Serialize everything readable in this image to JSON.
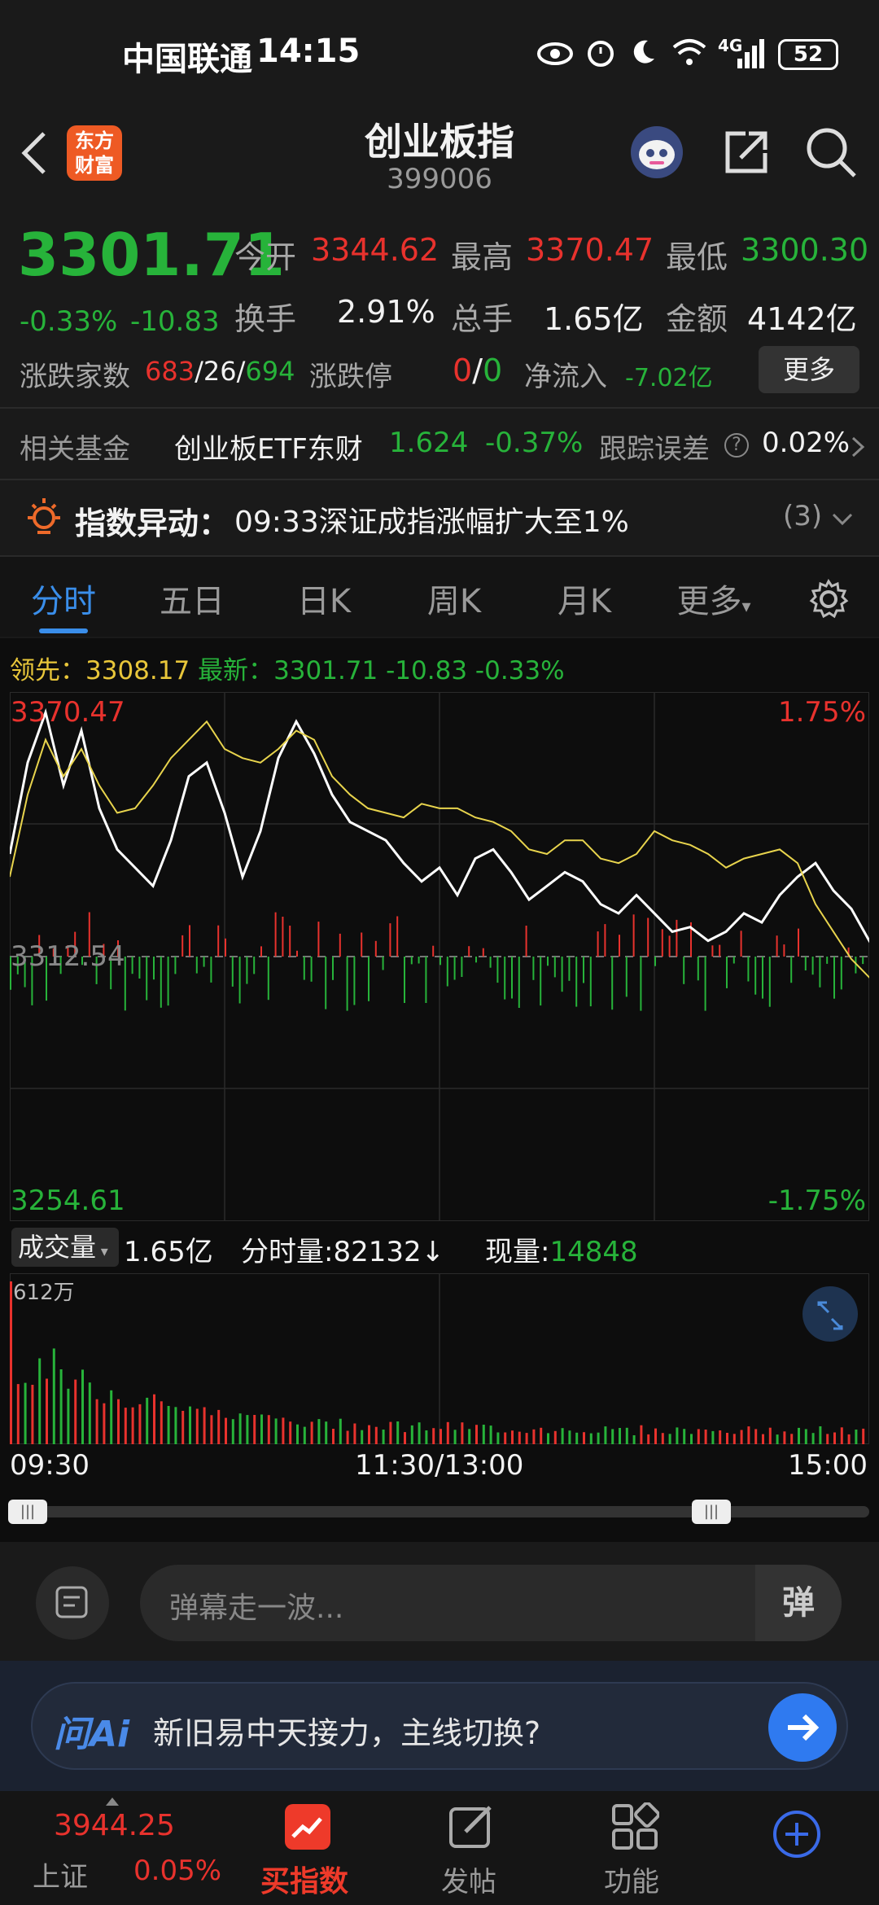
{
  "status_bar": {
    "carrier": "中国联通",
    "time": "14:15",
    "network": "4G",
    "battery": "52"
  },
  "header": {
    "logo_line1": "东方",
    "logo_line2": "财富",
    "title": "创业板指",
    "code": "399006"
  },
  "quote": {
    "price": "3301.71",
    "change_pct": "-0.33%",
    "change": "-10.83",
    "open_label": "今开",
    "open": "3344.62",
    "high_label": "最高",
    "high": "3370.47",
    "low_label": "最低",
    "low": "3300.30",
    "turnover_label": "换手",
    "turnover": "2.91%",
    "volume_label": "总手",
    "volume": "1.65亿",
    "amount_label": "金额",
    "amount": "4142亿",
    "breadth_label": "涨跌家数",
    "breadth_up": "683",
    "breadth_sep1": "/",
    "breadth_flat": "26",
    "breadth_sep2": "/",
    "breadth_down": "694",
    "limit_label": "涨跌停",
    "limit_up": "0",
    "limit_sep": "/",
    "limit_down": "0",
    "inflow_label": "净流入",
    "inflow": "-7.02亿",
    "more_button": "更多"
  },
  "fund": {
    "label": "相关基金",
    "name": "创业板ETF东财",
    "price": "1.624",
    "pct": "-0.37%",
    "error_label": "跟踪误差",
    "error": "0.02%"
  },
  "alert": {
    "label": "指数异动：",
    "text": "09:33深证成指涨幅扩大至1%",
    "count": "(3)"
  },
  "tabs": [
    {
      "label": "分时"
    },
    {
      "label": "五日"
    },
    {
      "label": "日K"
    },
    {
      "label": "周K"
    },
    {
      "label": "月K"
    },
    {
      "label": "更多"
    }
  ],
  "chart_info": {
    "lead_label": "领先：",
    "lead": "3308.17",
    "latest_label": "最新：",
    "latest": "3301.71",
    "change": "-10.83",
    "pct": "-0.33%"
  },
  "chart_data": {
    "type": "line",
    "y_labels": {
      "top": "3370.47",
      "mid": "3312.54",
      "bottom": "3254.61",
      "top_pct": "1.75%",
      "bottom_pct": "-1.75%"
    },
    "ylim": [
      3254.61,
      3370.47
    ],
    "prev_close": 3312.54,
    "series": [
      {
        "color": "#ffffff",
        "values": [
          3335,
          3355,
          3366,
          3350,
          3362,
          3345,
          3336,
          3332,
          3328,
          3338,
          3352,
          3355,
          3344,
          3330,
          3340,
          3356,
          3364,
          3357,
          3348,
          3342,
          3340,
          3338,
          3333,
          3329,
          3332,
          3326,
          3334,
          3336,
          3331,
          3325,
          3328,
          3331,
          3329,
          3324,
          3322,
          3326,
          3322,
          3318,
          3319,
          3316,
          3318,
          3322,
          3320,
          3326,
          3330,
          3333,
          3327,
          3323,
          3316,
          3310,
          3303,
          3304,
          3307,
          3308,
          3305,
          3306,
          3304,
          3302,
          3298,
          3301,
          3300,
          3302,
          3299,
          3300
        ]
      },
      {
        "color": "#e8d44d",
        "values": [
          3330,
          3348,
          3360,
          3352,
          3358,
          3350,
          3344,
          3345,
          3350,
          3356,
          3360,
          3364,
          3358,
          3356,
          3355,
          3358,
          3362,
          3360,
          3352,
          3348,
          3345,
          3344,
          3343,
          3346,
          3345,
          3345,
          3343,
          3342,
          3340,
          3336,
          3335,
          3338,
          3338,
          3334,
          3333,
          3335,
          3340,
          3338,
          3337,
          3335,
          3332,
          3334,
          3335,
          3336,
          3333,
          3324,
          3318,
          3312,
          3308,
          3312,
          3311,
          3306,
          3308,
          3309,
          3306,
          3307,
          3305,
          3304,
          3303,
          3306,
          3305,
          3307,
          3306,
          3308
        ]
      }
    ]
  },
  "volume": {
    "dropdown_label": "成交量",
    "total": "1.65亿",
    "minute_label": "分时量:",
    "minute": "82132↓",
    "now_label": "现量:",
    "now": "14848",
    "max_label": "612万"
  },
  "time_axis": {
    "start": "09:30",
    "mid": "11:30/13:00",
    "end": "15:00"
  },
  "input": {
    "placeholder": "弹幕走一波...",
    "send": "弹"
  },
  "ai": {
    "logo": "问Ai",
    "text": "新旧易中天接力，主线切换?"
  },
  "bottom_nav": {
    "sh_price": "3944.25",
    "sh_label": "上证",
    "sh_pct": "0.05%",
    "buy_label": "买指数",
    "post_label": "发帖",
    "func_label": "功能"
  }
}
